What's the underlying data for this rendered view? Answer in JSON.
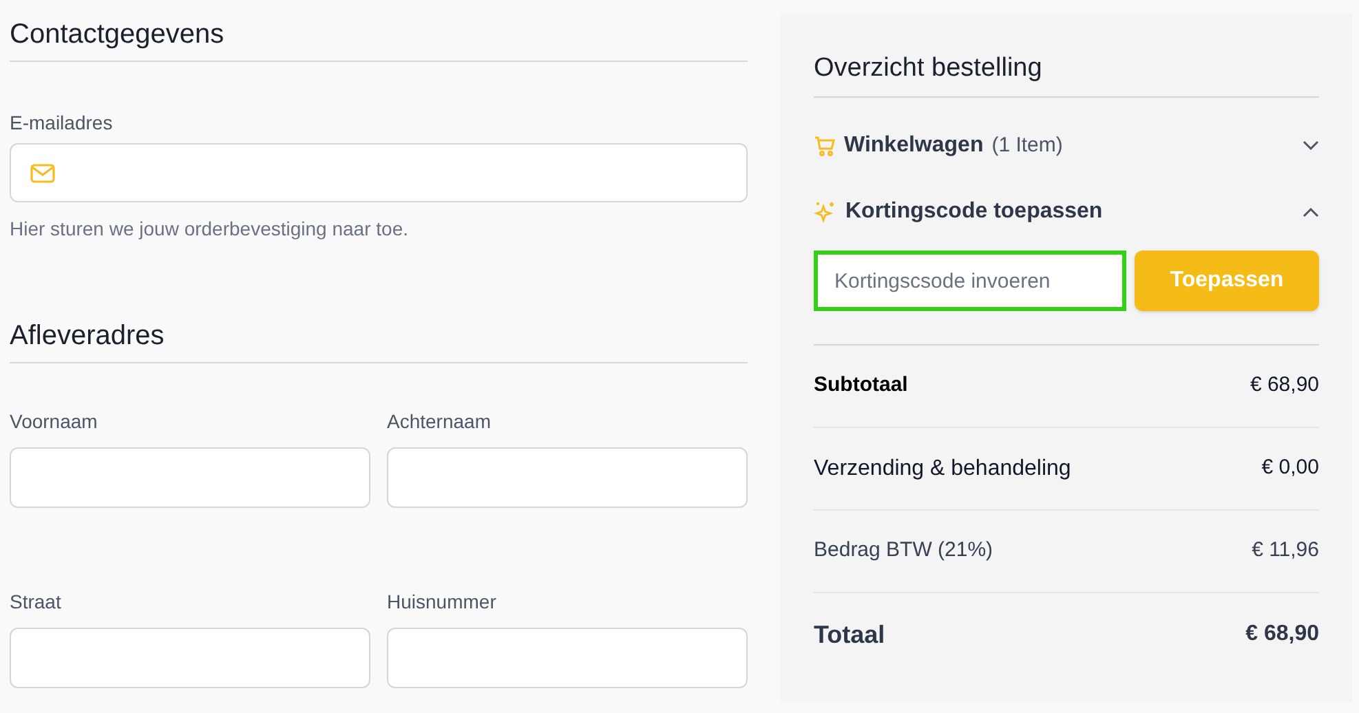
{
  "contact": {
    "title": "Contactgegevens",
    "email": {
      "label": "E-mailadres",
      "help": "Hier sturen we jouw orderbevestiging naar toe."
    }
  },
  "delivery": {
    "title": "Afleveradres",
    "fields": [
      {
        "label": "Voornaam"
      },
      {
        "label": "Achternaam"
      },
      {
        "label": "Straat"
      },
      {
        "label": "Huisnummer"
      }
    ]
  },
  "summary": {
    "title": "Overzicht bestelling",
    "sections": [
      {
        "kind": "cart",
        "title": "Winkelwagen",
        "count": "(1 Item)",
        "expanded": false
      },
      {
        "kind": "discount",
        "title": "Kortingscode toepassen",
        "expanded": true
      }
    ],
    "discount": {
      "placeholder": "Kortingscsode invoeren",
      "focused": true,
      "button": "Toepassen"
    },
    "rows": [
      {
        "kind": "subtotal",
        "label": "Subtotaal",
        "value": "€ 68,90"
      },
      {
        "kind": "normal",
        "label": "Verzending & behandeling",
        "value": "€ 0,00"
      },
      {
        "kind": "tax",
        "label": "Bedrag BTW (21%)",
        "value": "€ 11,96"
      },
      {
        "kind": "total",
        "label": "Totaal",
        "value": "€ 68,90"
      }
    ]
  }
}
